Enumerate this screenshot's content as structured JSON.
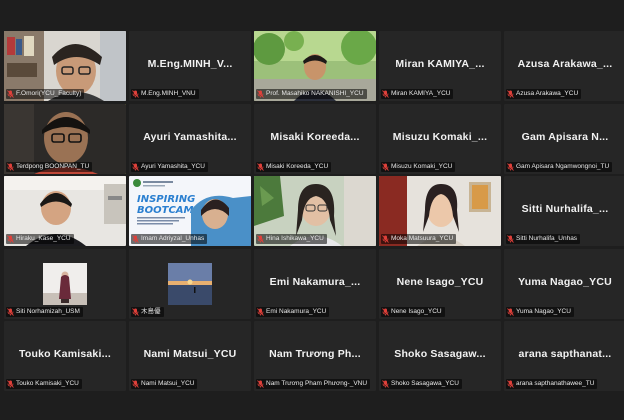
{
  "participants": [
    {
      "display_name": "",
      "label": "F.Omori(YCU_Faculty)",
      "video": "person-glasses-bookshelf"
    },
    {
      "display_name": "M.Eng.MINH_V...",
      "label": "M.Eng.MINH_VNU",
      "video": "none"
    },
    {
      "display_name": "",
      "label": "Prof. Masahiko NAKANISHI_YCU",
      "video": "person-trees-outdoor"
    },
    {
      "display_name": "Miran KAMIYA_...",
      "label": "Miran KAMIYA_YCU",
      "video": "none"
    },
    {
      "display_name": "Azusa Arakawa_...",
      "label": "Azusa Arakawa_YCU",
      "video": "none"
    },
    {
      "display_name": "",
      "label": "Terdpong BOONPAN_TU",
      "video": "person-glasses-dark",
      "speaking": true
    },
    {
      "display_name": "Ayuri Yamashita...",
      "label": "Ayuri Yamashita_YCU",
      "video": "none"
    },
    {
      "display_name": "Misaki Koreeda...",
      "label": "Misaki Koreeda_YCU",
      "video": "none"
    },
    {
      "display_name": "Misuzu Komaki_...",
      "label": "Misuzu Komaki_YCU",
      "video": "none"
    },
    {
      "display_name": "Gam Apisara N...",
      "label": "Gam Apisara Ngamwongnoi_TU",
      "video": "none"
    },
    {
      "display_name": "",
      "label": "Hiraku_Kase_YCU",
      "video": "person-room"
    },
    {
      "display_name": "",
      "label": "Imam Adriyzal_Unhas",
      "video": "inspiring-bootcamp",
      "slide_title_1": "INSPIRING",
      "slide_title_2": "BOOTCAMP"
    },
    {
      "display_name": "",
      "label": "Hina Ishikawa_YCU",
      "video": "person-plants"
    },
    {
      "display_name": "",
      "label": "Moka Matsuura_YCU",
      "video": "person-red-door"
    },
    {
      "display_name": "Sitti Nurhalifa_...",
      "label": "Sitti Nurhalifa_Unhas",
      "video": "none"
    },
    {
      "display_name": "",
      "label": "Siti Norhamizah_USM",
      "video": "photo-figure"
    },
    {
      "display_name": "",
      "label": "木島優",
      "video": "photo-sea"
    },
    {
      "display_name": "Emi Nakamura_...",
      "label": "Emi Nakamura_YCU",
      "video": "none"
    },
    {
      "display_name": "Nene Isago_YCU",
      "label": "Nene Isago_YCU",
      "video": "none"
    },
    {
      "display_name": "Yuma Nagao_YCU",
      "label": "Yuma Nagao_YCU",
      "video": "none"
    },
    {
      "display_name": "Touko Kamisaki...",
      "label": "Touko Kamisaki_YCU",
      "video": "none"
    },
    {
      "display_name": "Nami Matsui_YCU",
      "label": "Nami Matsui_YCU",
      "video": "none"
    },
    {
      "display_name": "Nam Trương Ph...",
      "label": "Nam Trương Pham Phương-_VNU",
      "video": "none"
    },
    {
      "display_name": "Shoko Sasagaw...",
      "label": "Shoko Sasagawa_YCU",
      "video": "none"
    },
    {
      "display_name": "arana sapthanat...",
      "label": "arana sapthanathawee_TU",
      "video": "none"
    }
  ],
  "colors": {
    "background": "#1e1e1e",
    "tile": "#262626",
    "speaking_outline": "#c8e03a",
    "muted_mic": "#e0403a"
  },
  "icons": {
    "mic": "muted-mic-icon"
  }
}
